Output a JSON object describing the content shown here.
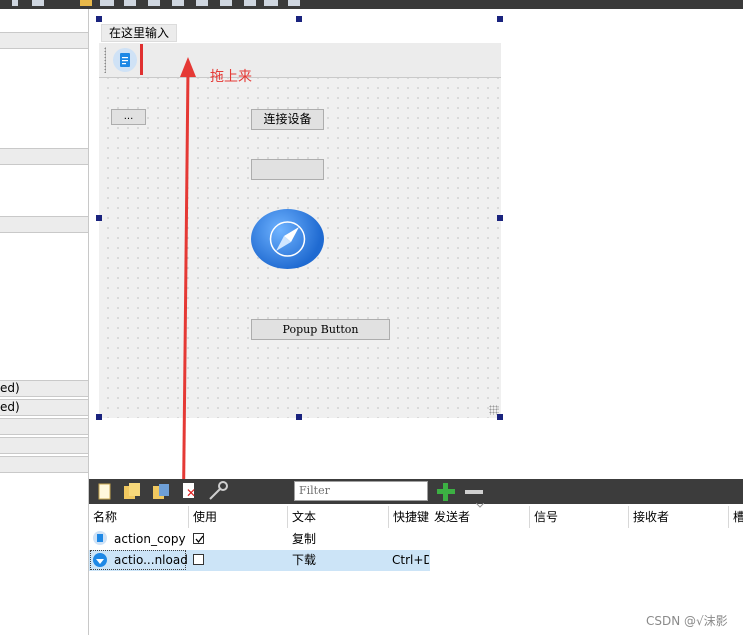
{
  "left_panel": {
    "partial_labels": [
      "ed)",
      "ed)"
    ]
  },
  "form": {
    "menu_item_label": "在这里输入",
    "ellipsis_button_label": "...",
    "connect_button_label": "连接设备",
    "popup_button_label": "Popup Button"
  },
  "annotation": {
    "drag_label": "拖上来",
    "color": "#e53935"
  },
  "action_editor": {
    "filter_placeholder": "Filter",
    "columns": [
      "名称",
      "使用",
      "文本",
      "快捷键"
    ],
    "rows": [
      {
        "name": "action_copy",
        "used": true,
        "text": "复制",
        "shortcut": ""
      },
      {
        "name": "actio...nload",
        "used": false,
        "text": "下载",
        "shortcut": "Ctrl+D"
      }
    ]
  },
  "signal_editor": {
    "columns": [
      "发送者",
      "信号",
      "接收者",
      "槽"
    ]
  },
  "watermark": "CSDN @√沫影"
}
